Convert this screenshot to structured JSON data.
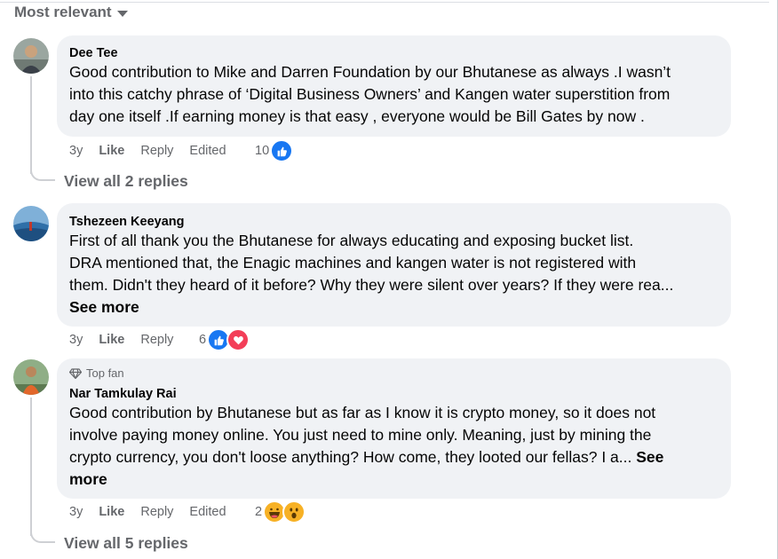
{
  "sort": {
    "label": "Most relevant",
    "icon": "caret-down-icon"
  },
  "comments": [
    {
      "author": "Dee Tee",
      "lines": [
        "Good contribution to Mike and Darren Foundation by our Bhutanese as always .I wasn’t",
        "into this catchy phrase of ‘Digital Business Owners’ and Kangen water superstition from",
        "day one itself .If earning money is that easy , everyone would be Bill Gates by now ."
      ],
      "time": "3y",
      "like": "Like",
      "reply": "Reply",
      "edited": "Edited",
      "reaction_count": "10",
      "reactions": [
        "like-icon"
      ],
      "view_replies": "View all 2 replies"
    },
    {
      "author": "Tshezeen Keeyang",
      "lines": [
        "First of all thank you the Bhutanese for always educating and exposing bucket list.",
        "DRA mentioned that, the Enagic machines and kangen water is not registered with",
        "them. Didn't they heard of it before? Why they were silent over years? If they were rea..."
      ],
      "see_more": "See more",
      "time": "3y",
      "like": "Like",
      "reply": "Reply",
      "reaction_count": "6",
      "reactions": [
        "like-icon",
        "love-icon"
      ]
    },
    {
      "badge": "Top fan",
      "author": "Nar Tamkulay Rai",
      "lines": [
        "Good contribution by Bhutanese but as far as I know it is crypto money, so it does not",
        "involve paying money online. You just need to mine only. Meaning, just by mining the",
        "crypto currency, you don't loose anything? How come, they looted our fellas? I a..."
      ],
      "see_more_a": "See",
      "see_more_b": "more",
      "time": "3y",
      "like": "Like",
      "reply": "Reply",
      "edited": "Edited",
      "reaction_count": "2",
      "reactions": [
        "haha-icon",
        "wow-icon"
      ],
      "view_replies": "View all 5 replies"
    }
  ],
  "colors": {
    "like_blue": "#1877f2",
    "love_red": "#f33e58",
    "emoji_yellow": "#f7b125",
    "muted": "#65676b",
    "bubble": "#f0f2f5"
  }
}
